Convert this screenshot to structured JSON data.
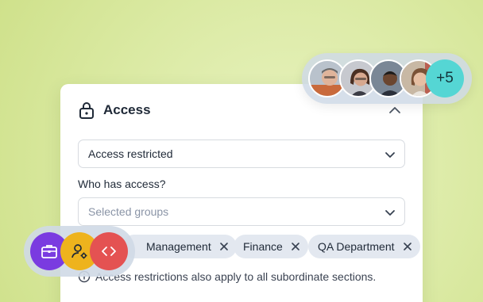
{
  "access_card": {
    "title": "Access",
    "access_select": {
      "value": "Access restricted"
    },
    "who_label": "Who has access?",
    "groups_select": {
      "placeholder": "Selected groups"
    },
    "chips": [
      {
        "label": "Management"
      },
      {
        "label": "Finance"
      },
      {
        "label": "QA Department"
      }
    ],
    "note": "Access restrictions also apply to all subordinate sections."
  },
  "avatars": {
    "more_count": "+5"
  },
  "tools": [
    "briefcase-icon",
    "user-settings-icon",
    "code-icon"
  ],
  "colors": {
    "background": "#dbeaa4",
    "tool_briefcase": "#7a3be0",
    "tool_user": "#eeb31d",
    "tool_code": "#e45252",
    "more_badge": "#55d6d4",
    "chip_bg": "#e3e8f0"
  }
}
